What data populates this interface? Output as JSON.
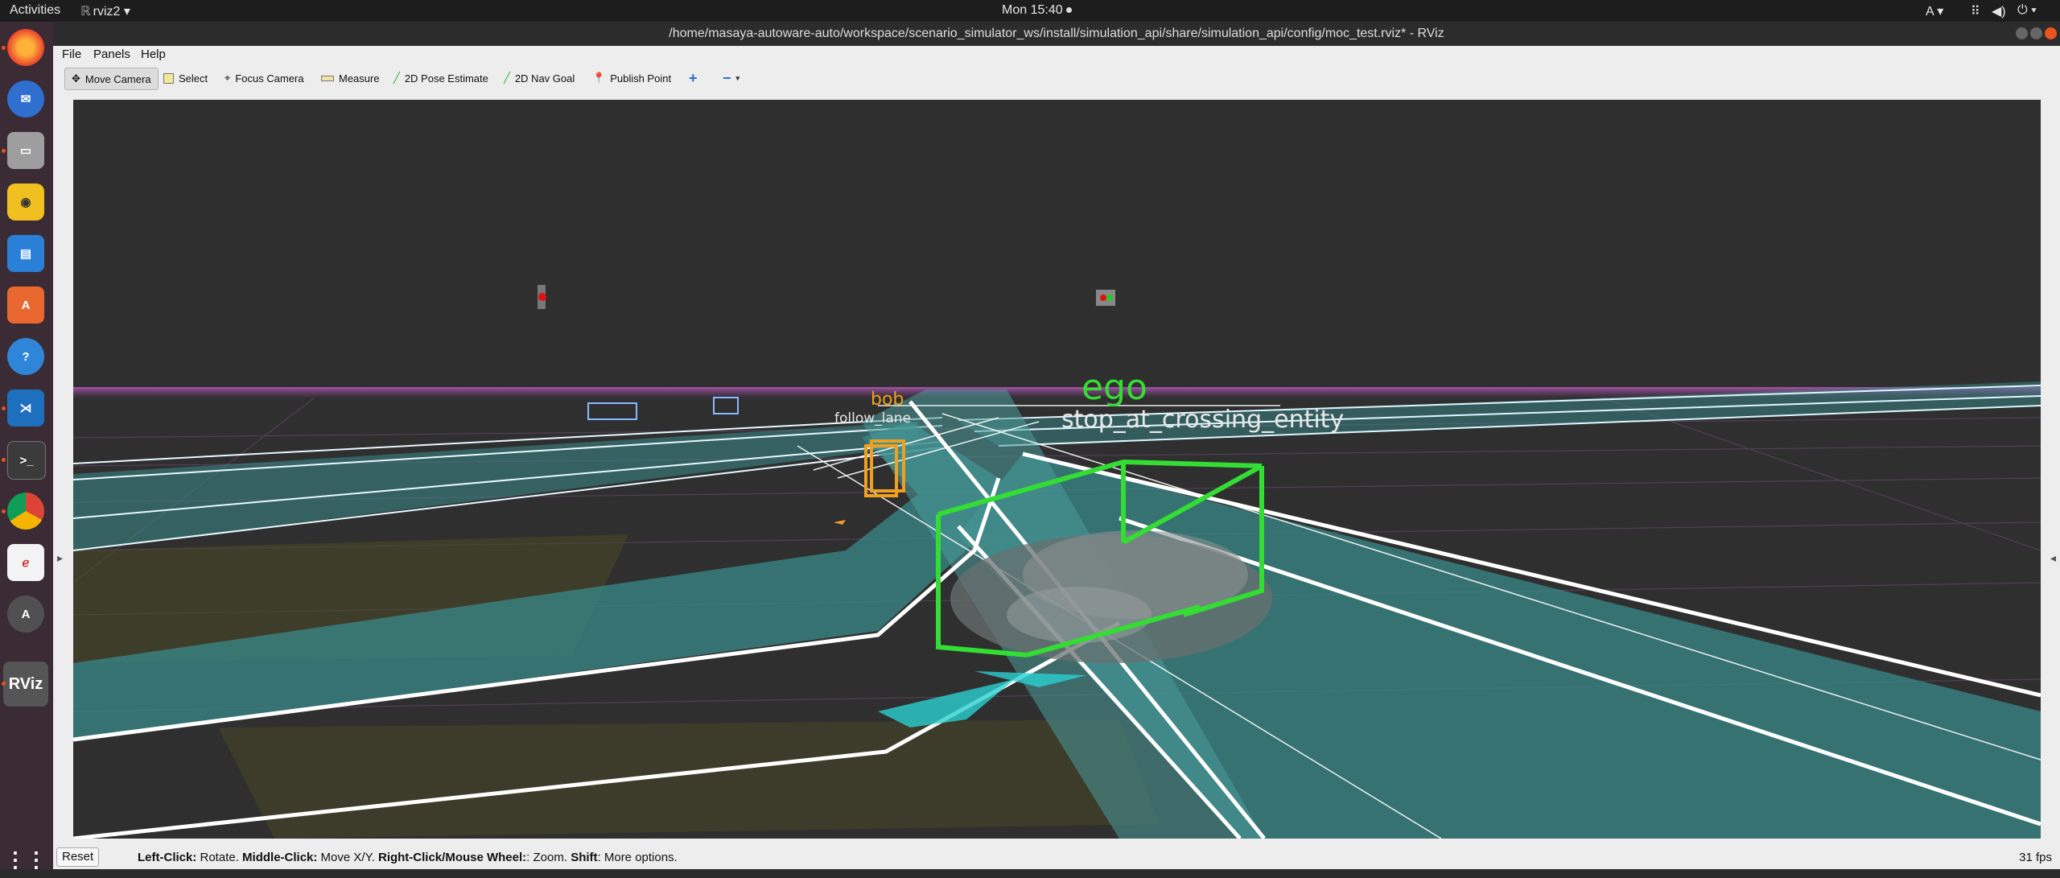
{
  "topbar": {
    "activities": "Activities",
    "app_name": "rviz2 ▾",
    "clock": "Mon 15:40",
    "input_method": "A ▾"
  },
  "window": {
    "title": "/home/masaya-autoware-auto/workspace/scenario_simulator_ws/install/simulation_api/share/simulation_api/config/moc_test.rviz* - RViz"
  },
  "menu": {
    "file": "File",
    "panels": "Panels",
    "help": "Help"
  },
  "toolbar": {
    "move_camera": "Move Camera",
    "select": "Select",
    "focus_camera": "Focus Camera",
    "measure": "Measure",
    "pose_estimate": "2D Pose Estimate",
    "nav_goal": "2D Nav Goal",
    "publish_point": "Publish Point"
  },
  "scene": {
    "ego_label": "ego",
    "ego_status": "stop_at_crossing_entity",
    "bob_label": "bob",
    "bob_status": "follow_lane",
    "ego_color": "#33dd33",
    "bob_color": "#f0a020"
  },
  "status": {
    "reset": "Reset",
    "left_click": "Left-Click:",
    "left_click_desc": " Rotate. ",
    "middle_click": "Middle-Click:",
    "middle_click_desc": " Move X/Y. ",
    "right_click": "Right-Click/Mouse Wheel:",
    "right_click_desc": ": Zoom. ",
    "shift": "Shift",
    "shift_desc": ": More options.",
    "fps": "31 fps"
  },
  "dock": {
    "icons": [
      "firefox-icon",
      "thunderbird-icon",
      "files-icon",
      "rhythmbox-icon",
      "writer-icon",
      "software-center-icon",
      "help-icon",
      "vscode-icon",
      "terminal-icon",
      "chrome-icon",
      "text-editor-icon",
      "updater-icon",
      "rviz-icon",
      "app-grid-icon"
    ]
  }
}
